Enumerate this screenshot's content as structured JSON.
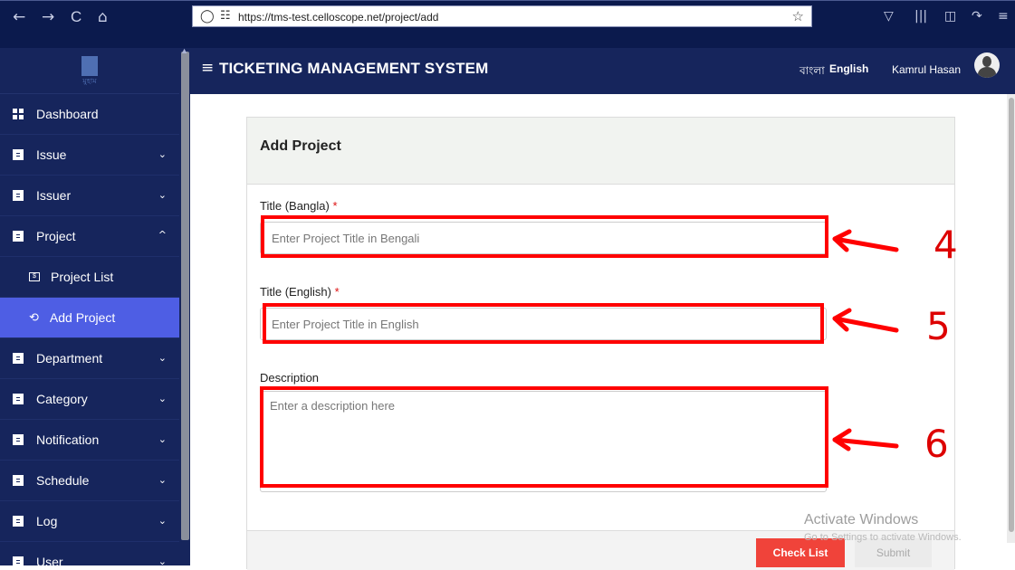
{
  "browser": {
    "url": "https://tms-test.celloscope.net/project/add",
    "back_icon": "←",
    "forward_icon": "→",
    "reload_icon": "C",
    "home_icon": "⌂",
    "shield_icon": "◯",
    "lock_icon": "🔒",
    "star_icon": "☆"
  },
  "sidebar": {
    "logo_text": "মুহাম",
    "items": [
      {
        "label": "Dashboard",
        "icon": "dashboard-icon"
      },
      {
        "label": "Issue",
        "icon": "list-icon"
      },
      {
        "label": "Issuer",
        "icon": "list-icon"
      },
      {
        "label": "Project",
        "icon": "list-icon"
      },
      {
        "label": "Project List",
        "icon": "project-list-icon"
      },
      {
        "label": "Add Project",
        "icon": "refresh-icon"
      },
      {
        "label": "Department",
        "icon": "list-icon"
      },
      {
        "label": "Category",
        "icon": "list-icon"
      },
      {
        "label": "Notification",
        "icon": "list-icon"
      },
      {
        "label": "Schedule",
        "icon": "list-icon"
      },
      {
        "label": "Log",
        "icon": "list-icon"
      },
      {
        "label": "User",
        "icon": "list-icon"
      }
    ],
    "chevron_down": "⌄",
    "chevron_up": "^",
    "sub_icon_glyph": "$"
  },
  "header": {
    "menu_icon": "≡",
    "title": "TICKETING MANAGEMENT SYSTEM",
    "lang_bangla": "বাংলা",
    "lang_english": "English",
    "user_name": "Kamrul Hasan"
  },
  "form": {
    "card_title": "Add Project",
    "title_bangla_label": "Title (Bangla)",
    "title_bangla_placeholder": "Enter Project Title in Bengali",
    "title_english_label": "Title (English)",
    "title_english_placeholder": "Enter Project Title in English",
    "required_mark": "*",
    "description_label": "Description",
    "description_placeholder": "Enter a description here",
    "check_list_label": "Check List",
    "submit_label": "Submit"
  },
  "watermark": {
    "line1": "Activate Windows",
    "line2": "Go to Settings to activate Windows."
  },
  "annotations": {
    "label_4": "4",
    "label_5": "5",
    "label_6": "6",
    "color": "#ff0000"
  }
}
